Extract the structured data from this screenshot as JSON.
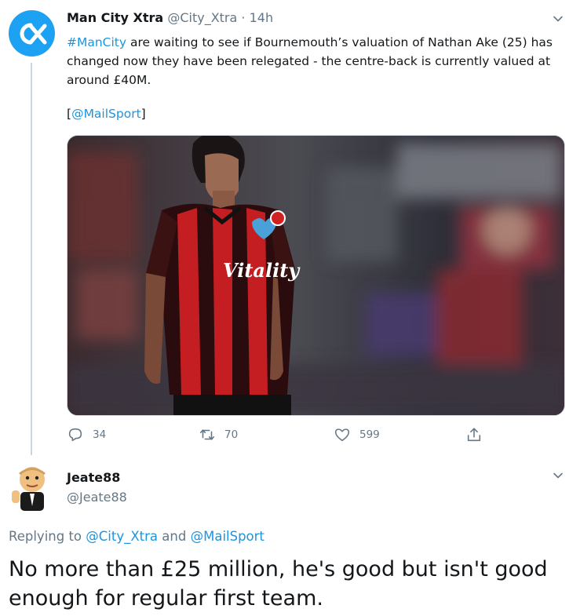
{
  "tweet": {
    "author_name": "Man City Xtra",
    "author_handle": "@City_Xtra",
    "separator": "·",
    "time": "14h",
    "hashtag": "#ManCity",
    "text": " are waiting to see if Bournemouth’s valuation of Nathan Ake (25) has changed now they have been relegated - the centre-back is currently valued at around £40M.",
    "source_open": "[",
    "source_mention": "@MailSport",
    "source_close": "]",
    "actions": {
      "reply_count": "34",
      "retweet_count": "70",
      "like_count": "599"
    }
  },
  "reply": {
    "author_name": "Jeate88",
    "author_handle": "@Jeate88",
    "replying_prefix": "Replying to ",
    "replying_to_1": "@City_Xtra",
    "replying_and": " and ",
    "replying_to_2": "@MailSport",
    "text": "No more than £25 million, he's good but isn't good enough for regular first team."
  },
  "media": {
    "sponsor": "Vitality"
  },
  "colors": {
    "link": "#1b95e0",
    "muted": "#657786",
    "avatar_bg": "#1da1f2"
  },
  "icons": [
    "cx-logo-icon",
    "chevron-down-icon",
    "reply-icon",
    "retweet-icon",
    "like-icon",
    "share-icon"
  ]
}
